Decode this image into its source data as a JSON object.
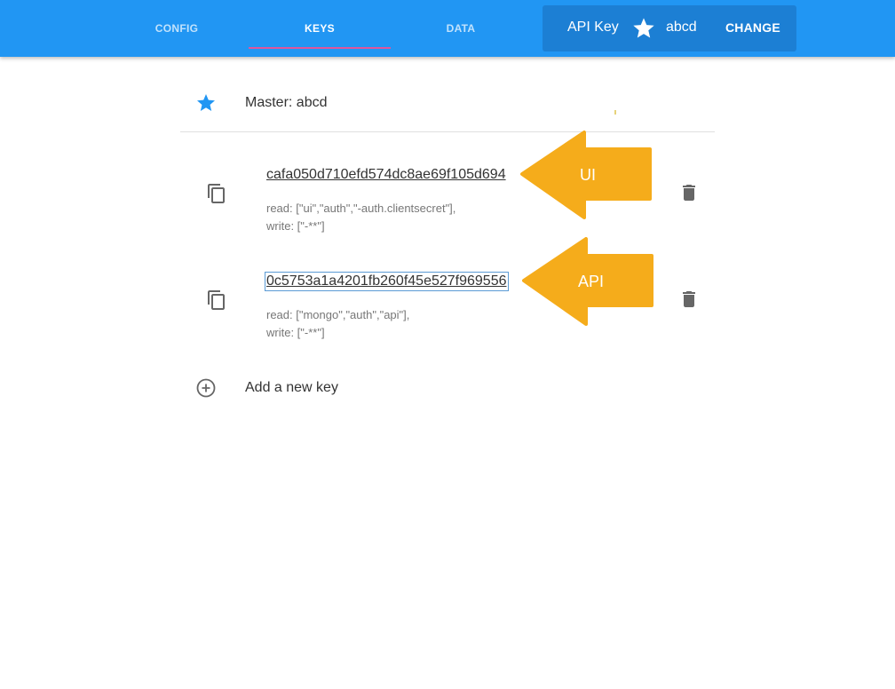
{
  "tabs": [
    {
      "label": "CONFIG",
      "active": false
    },
    {
      "label": "KEYS",
      "active": true
    },
    {
      "label": "DATA",
      "active": false
    }
  ],
  "api_key": {
    "label": "API Key",
    "icon": "star-icon",
    "value": "abcd",
    "change_label": "CHANGE"
  },
  "master": {
    "icon": "star-icon",
    "label": "Master: abcd"
  },
  "keys": [
    {
      "key": "cafa050d710efd574dc8ae69f105d694",
      "read": "read: [\"ui\",\"auth\",\"-auth.clientsecret\"],",
      "write": "write: [\"-**\"]",
      "callout": "UI"
    },
    {
      "key": "0c5753a1a4201fb260f45e527f969556",
      "read": "read: [\"mongo\",\"auth\",\"api\"],",
      "write": "write: [\"-**\"]",
      "callout": "API"
    }
  ],
  "add_key": {
    "icon": "add-circle-icon",
    "label": "Add a new key"
  },
  "colors": {
    "primary": "#2196f3",
    "indicator": "#e0559d",
    "callout": "#f5a80f"
  }
}
